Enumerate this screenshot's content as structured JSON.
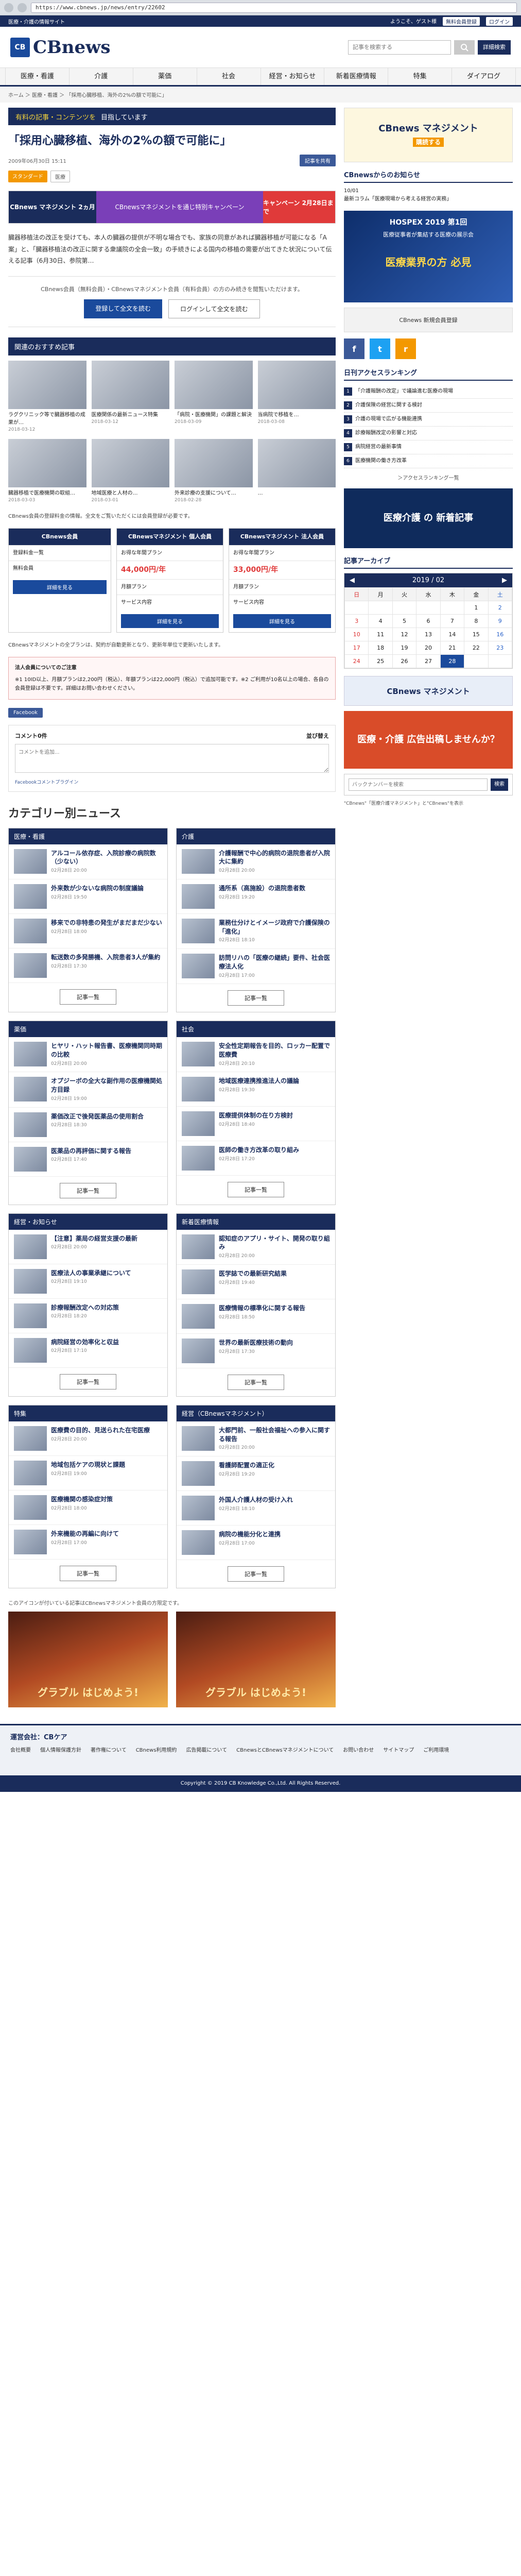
{
  "browser": {
    "url": "https://www.cbnews.jp/news/entry/22602"
  },
  "topbar": {
    "left": "医療・介護の情報サイト",
    "welcome": "ようこそ、ゲスト様",
    "member": "無料会員登録",
    "login": "ログイン"
  },
  "header": {
    "logo_mark": "CB",
    "logo_text": "CBnews",
    "search_placeholder": "記事を検索する",
    "advanced": "詳細検索"
  },
  "nav": [
    "医療・看護",
    "介護",
    "薬価",
    "社会",
    "経営・お知らせ",
    "新着医療情報",
    "特集",
    "ダイアログ"
  ],
  "breadcrumb": "ホーム ＞ 医療・看護 ＞ 「採用心臓移植、海外の2%の額で可能に」",
  "premium_banner": {
    "badge": "有料の記事・コンテンツを",
    "text": "目指しています"
  },
  "article": {
    "title": "「採用心臓移植、海外の2%の額で可能に」",
    "date": "2009年06月30日 15:11",
    "share": "記事を共有",
    "tag_premium": "スタンダード",
    "tag_field": "医療",
    "promo_left": "CBnews マネジメント 2ヵ月",
    "promo_mid": "CBnewsマネジメントを通じ特別キャンペーン",
    "promo_right": "キャンペーン 2月28日まで",
    "lead": "臓器移植法の改正を受けても、本人の臓器の提供が不明な場合でも、家族の同意があれば臓器移植が可能になる「A案」と、「臓器移植法の改正に関する衆議院の全会一致」の手続きによる国内の移植の需要が出てきた状況について伝える記事（6月30日、参院第…",
    "paywall_note": "CBnews会員（無料会員）・CBnewsマネジメント会員（有料会員）の方のみ続きを閲覧いただけます。",
    "btn_register": "登録して全文を読む",
    "btn_login": "ログインして全文を読む"
  },
  "recommend": {
    "heading": "関連のおすすめ記事",
    "items": [
      {
        "title": "ラグクリニック等で臓器移植の成果が…",
        "date": "2018-03-12"
      },
      {
        "title": "医療関係の最新ニュース特集",
        "date": "2018-03-12"
      },
      {
        "title": "「病院・医療機関」の課題と解決",
        "date": "2018-03-09"
      },
      {
        "title": "当病院で移植を…",
        "date": "2018-03-08"
      },
      {
        "title": "臓器移植で医療機関の取組…",
        "date": "2018-03-03"
      },
      {
        "title": "地域医療と人材の…",
        "date": "2018-03-01"
      },
      {
        "title": "外来診療の支援について…",
        "date": "2018-02-28"
      },
      {
        "title": "…",
        "date": ""
      }
    ]
  },
  "plan_note": "CBnews会員の登録料金の情報。全文をご覧いただくには会員登録が必要です。",
  "plans": {
    "col1_head": "CBnews会員",
    "col1_rows": [
      "登録料金一覧",
      "無料会員"
    ],
    "col2_head": "CBnewsマネジメント 個人会員",
    "col2_price": "44,000円/年",
    "col2_rows": [
      "お得な年間プラン",
      "月額プラン",
      "サービス内容"
    ],
    "col2_cta": "詳細を見る",
    "col3_head": "CBnewsマネジメント 法人会員",
    "col3_price": "33,000円/年",
    "col3_rows": [
      "お得な年間プラン",
      "月額プラン",
      "サービス内容"
    ],
    "col3_cta": "詳細を見る",
    "col1_cta": "詳細を見る"
  },
  "plan_after_note": "CBnewsマネジメントの全プランは、契約が自動更新となり、更新年単位で更新いたします。",
  "notice": {
    "title": "法人会員についてのご注意",
    "body": "※1 10ID以上、月額プランは2,200円（税込）、年額プランは22,000円（税込）で追加可能です。※2 ご利用が10名以上の場合、各自の会員登録は不要です。詳細はお問い合わせください。"
  },
  "social": {
    "fb": "Facebook"
  },
  "comments": {
    "title": "コメント0件",
    "sort": "並び替え",
    "placeholder": "コメントを追加...",
    "plugin": "Facebookコメントプラグイン"
  },
  "category_title": "カテゴリー別ニュース",
  "categories": [
    {
      "name": "医療・看護",
      "items": [
        {
          "title": "アルコール依存症、入院診療の病院数（少ない）",
          "date": "02月28日 20:00"
        },
        {
          "title": "外来数が少ないな病院の制度議論",
          "date": "02月28日 19:50"
        },
        {
          "title": "移来での非特患の発生がまだまだ少ない",
          "date": "02月28日 18:00"
        },
        {
          "title": "転送数の多発勝機、入院患者3人が集約",
          "date": "02月28日 17:30"
        }
      ]
    },
    {
      "name": "介護",
      "items": [
        {
          "title": "介護報酬で中心的病院の退院患者が入院大に集約",
          "date": "02月28日 20:00"
        },
        {
          "title": "通所系（高施設）の退院患者数",
          "date": "02月28日 19:20"
        },
        {
          "title": "業務仕分けとイメージ政府で介護保険の「進化」",
          "date": "02月28日 18:10"
        },
        {
          "title": "訪問リハの「医療の継続」要件、社会医療法人化",
          "date": "02月28日 17:00"
        }
      ]
    },
    {
      "name": "薬価",
      "items": [
        {
          "title": "ヒヤリ・ハット報告書、医療機関同時期の比較",
          "date": "02月28日 20:00"
        },
        {
          "title": "オプジーボの全大な副作用の医療機関処方目録",
          "date": "02月28日 19:00"
        },
        {
          "title": "薬価改正で後発医薬品の使用割合",
          "date": "02月28日 18:30"
        },
        {
          "title": "医薬品の再評価に関する報告",
          "date": "02月28日 17:40"
        }
      ]
    },
    {
      "name": "社会",
      "items": [
        {
          "title": "安全性定期報告を目的、ロッカー配置で医療費",
          "date": "02月28日 20:10"
        },
        {
          "title": "地域医療連携推進法人の議論",
          "date": "02月28日 19:30"
        },
        {
          "title": "医療提供体制の在り方検討",
          "date": "02月28日 18:40"
        },
        {
          "title": "医師の働き方改革の取り組み",
          "date": "02月28日 17:20"
        }
      ]
    },
    {
      "name": "経営・お知らせ",
      "items": [
        {
          "title": "【注意】薬局の経営支援の最新",
          "date": "02月28日 20:00"
        },
        {
          "title": "医療法人の事業承継について",
          "date": "02月28日 19:10"
        },
        {
          "title": "診療報酬改定への対応策",
          "date": "02月28日 18:20"
        },
        {
          "title": "病院経営の効率化と収益",
          "date": "02月28日 17:10"
        }
      ]
    },
    {
      "name": "新着医療情報",
      "items": [
        {
          "title": "認知症のアプリ・サイト、開発の取り組み",
          "date": "02月28日 20:00"
        },
        {
          "title": "医学誌での最新研究結果",
          "date": "02月28日 19:40"
        },
        {
          "title": "医療情報の標準化に関する報告",
          "date": "02月28日 18:50"
        },
        {
          "title": "世界の最新医療技術の動向",
          "date": "02月28日 17:30"
        }
      ]
    },
    {
      "name": "特集",
      "items": [
        {
          "title": "医療費の目的、見送られた在宅医療",
          "date": "02月28日 20:00"
        },
        {
          "title": "地域包括ケアの現状と課題",
          "date": "02月28日 19:00"
        },
        {
          "title": "医療機関の感染症対策",
          "date": "02月28日 18:00"
        },
        {
          "title": "外来機能の再編に向けて",
          "date": "02月28日 17:00"
        }
      ]
    },
    {
      "name": "経営（CBnewsマネジメント）",
      "items": [
        {
          "title": "大都門前、一般社会福祉への参入に関する報告",
          "date": "02月28日 20:00"
        },
        {
          "title": "看護師配置の適正化",
          "date": "02月28日 19:20"
        },
        {
          "title": "外国人介護人材の受け入れ",
          "date": "02月28日 18:10"
        },
        {
          "title": "病院の機能分化と連携",
          "date": "02月28日 17:00"
        }
      ]
    }
  ],
  "category_more": "記事一覧",
  "free_note": "このアイコンが付いている記事はCBnewsマネジメント会員の方限定です。",
  "ad_pair": [
    "グラブル はじめよう!",
    "グラブル はじめよう!"
  ],
  "side": {
    "ad_top": "CBnews マネジメント",
    "ad_top_badge": "購読する",
    "notice_heading": "CBnewsからのお知らせ",
    "notice_date": "10/01",
    "notice_text": "最新コラム「医療現場から考える経営の実務」",
    "hospex_title": "HOSPEX 2019 第1回",
    "hospex_sub": "医療従事者が集結する医療の展示会",
    "hospex_cta": "医療業界の方 必見",
    "small_ad": "CBnews 新規会員登録",
    "social": [
      "f",
      "t",
      "r"
    ],
    "rank_heading": "日刊アクセスランキング",
    "ranking": [
      "「介護報酬の改定」で議論進む医療の現場",
      "介護保険の経営に関する検討",
      "介護の現場で広がる機能連携",
      "診療報酬改定の影響と対応",
      "病院経営の最新事情",
      "医療機関の働き方改革"
    ],
    "rank_more": "＞アクセスランキング一覧",
    "ad2": "医療介護 の 新着記事",
    "cal_heading": "記事アーカイブ",
    "cal_year": "2019",
    "cal_month": "02",
    "weekdays": [
      "日",
      "月",
      "火",
      "水",
      "木",
      "金",
      "土"
    ],
    "weeks": [
      [
        "",
        "",
        "",
        "",
        "",
        "1",
        "2"
      ],
      [
        "3",
        "4",
        "5",
        "6",
        "7",
        "8",
        "9"
      ],
      [
        "10",
        "11",
        "12",
        "13",
        "14",
        "15",
        "16"
      ],
      [
        "17",
        "18",
        "19",
        "20",
        "21",
        "22",
        "23"
      ],
      [
        "24",
        "25",
        "26",
        "27",
        "28",
        "",
        ""
      ]
    ],
    "cal_today": "28",
    "ad3": "CBnews マネジメント",
    "ad4": "医療・介護 広告出稿しませんか？",
    "search_placeholder": "バックナンバーを検索",
    "search_btn": "検索",
    "side_note": "\"CBnews\"「医療介護マネジメント」と\"CBnews\"を表示"
  },
  "footer": {
    "brand": "運営会社：CBケア",
    "links": [
      "会社概要",
      "個人情報保護方針",
      "著作権について",
      "CBnews利用規約",
      "広告掲載について",
      "CBnewsとCBnewsマネジメントについて",
      "お問い合わせ",
      "サイトマップ",
      "ご利用環境"
    ],
    "copyright": "Copyright © 2019 CB Knowledge Co.,Ltd. All Rights Reserved."
  }
}
